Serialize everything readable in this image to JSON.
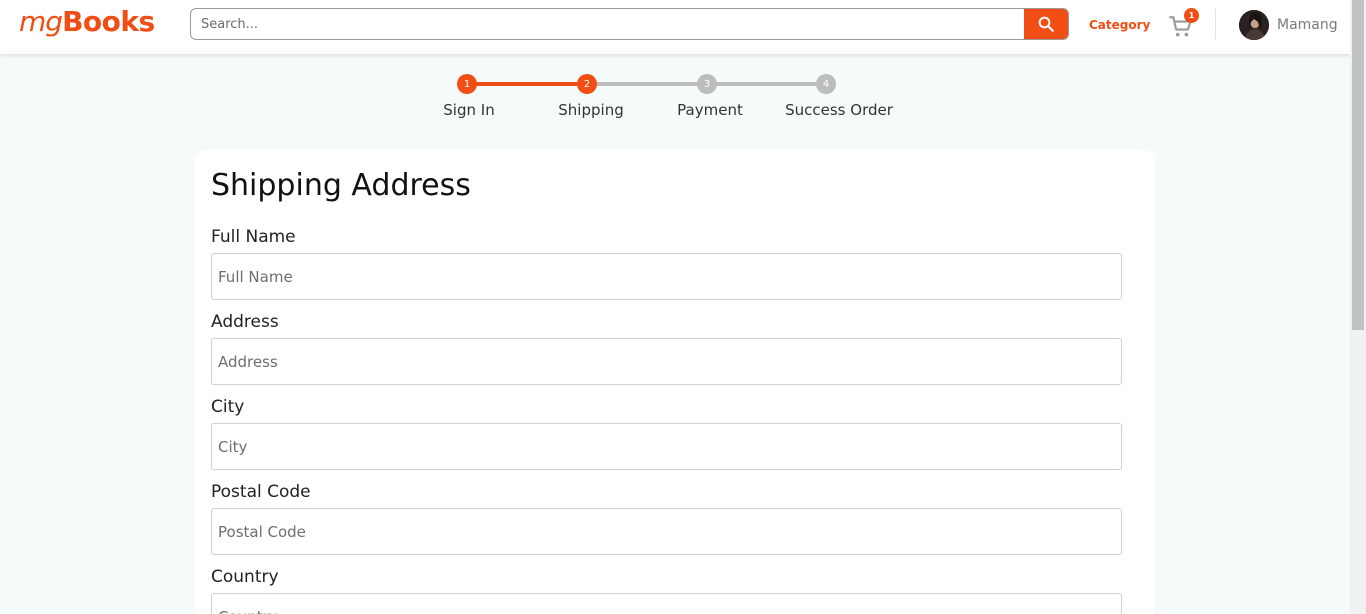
{
  "header": {
    "logo_prefix": "mg",
    "logo_main": "Books",
    "search_placeholder": "Search...",
    "category_label": "Category",
    "cart_count": "1",
    "user_name": "Mamang"
  },
  "stepper": {
    "steps": [
      {
        "number": "1",
        "label": "Sign In",
        "state": "done"
      },
      {
        "number": "2",
        "label": "Shipping",
        "state": "active"
      },
      {
        "number": "3",
        "label": "Payment",
        "state": "pending"
      },
      {
        "number": "4",
        "label": "Success Order",
        "state": "pending"
      }
    ]
  },
  "form": {
    "title": "Shipping Address",
    "fields": [
      {
        "label": "Full Name",
        "placeholder": "Full Name",
        "value": ""
      },
      {
        "label": "Address",
        "placeholder": "Address",
        "value": ""
      },
      {
        "label": "City",
        "placeholder": "City",
        "value": ""
      },
      {
        "label": "Postal Code",
        "placeholder": "Postal Code",
        "value": ""
      },
      {
        "label": "Country",
        "placeholder": "Country",
        "value": ""
      }
    ]
  },
  "colors": {
    "accent": "#f04e14",
    "step_pending": "#bdbdbd",
    "page_bg": "#f5fbfb"
  },
  "icons": {
    "search": "search-icon",
    "cart": "cart-icon",
    "avatar": "avatar-image"
  }
}
